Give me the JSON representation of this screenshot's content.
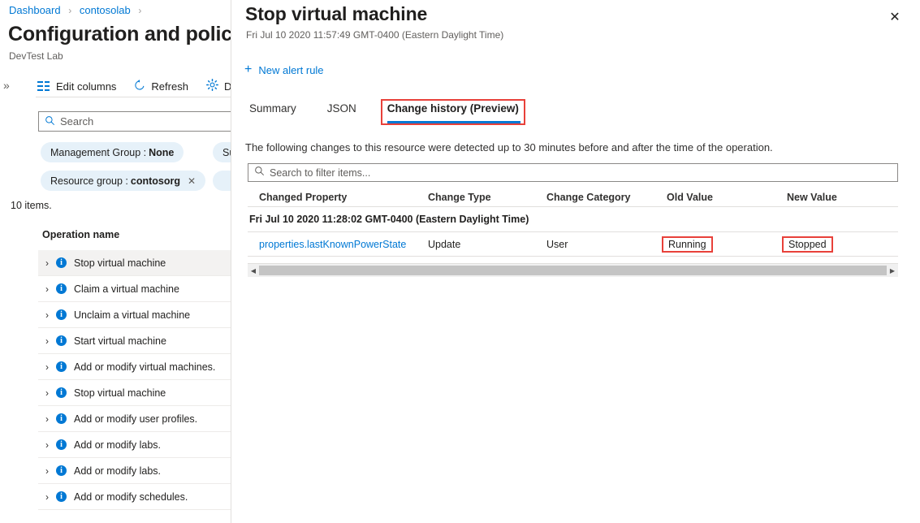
{
  "breadcrumb": {
    "items": [
      "Dashboard",
      "contosolab"
    ],
    "separator": "›"
  },
  "left_blade": {
    "title": "Configuration and policie",
    "subtitle": "DevTest Lab",
    "expand_icon": "»",
    "toolbar": [
      {
        "label": "Edit columns",
        "icon": "columns-icon"
      },
      {
        "label": "Refresh",
        "icon": "refresh-icon"
      },
      {
        "label": "D",
        "icon": "gear-icon"
      }
    ],
    "search": {
      "placeholder": "Search",
      "icon": "search-icon"
    },
    "filters": [
      {
        "label": "Management Group :",
        "value": "None",
        "removable": false
      },
      {
        "label": "Su",
        "value": "",
        "removable": false
      },
      {
        "label": "Resource group :",
        "value": "contosorg",
        "removable": true
      },
      {
        "label": "",
        "value": "",
        "removable": false
      }
    ],
    "items_count": "10 items.",
    "column_header": "Operation name",
    "operations": [
      {
        "label": "Stop virtual machine",
        "selected": true
      },
      {
        "label": "Claim a virtual machine",
        "selected": false
      },
      {
        "label": "Unclaim a virtual machine",
        "selected": false
      },
      {
        "label": "Start virtual machine",
        "selected": false
      },
      {
        "label": "Add or modify virtual machines.",
        "selected": false
      },
      {
        "label": "Stop virtual machine",
        "selected": false
      },
      {
        "label": "Add or modify user profiles.",
        "selected": false
      },
      {
        "label": "Add or modify labs.",
        "selected": false
      },
      {
        "label": "Add or modify labs.",
        "selected": false
      },
      {
        "label": "Add or modify schedules.",
        "selected": false
      }
    ]
  },
  "panel": {
    "title": "Stop virtual machine",
    "subtitle": "Fri Jul 10 2020 11:57:49 GMT-0400 (Eastern Daylight Time)",
    "close_icon": "✕",
    "command": {
      "label": "New alert rule",
      "icon": "plus-icon",
      "plus": "+"
    },
    "tabs": [
      {
        "label": "Summary",
        "active": false,
        "highlighted": false
      },
      {
        "label": "JSON",
        "active": false,
        "highlighted": false
      },
      {
        "label": "Change history (Preview)",
        "active": true,
        "highlighted": true
      }
    ],
    "description": "The following changes to this resource were detected up to 30 minutes before and after the time of the operation.",
    "filter": {
      "placeholder": "Search to filter items...",
      "icon": "search-icon"
    },
    "table": {
      "columns": [
        "Changed Property",
        "Change Type",
        "Change Category",
        "Old Value",
        "New Value"
      ],
      "group_label": "Fri Jul 10 2020 11:28:02 GMT-0400 (Eastern Daylight Time)",
      "rows": [
        {
          "changed_property": "properties.lastKnownPowerState",
          "change_type": "Update",
          "change_category": "User",
          "old_value": "Running",
          "new_value": "Stopped",
          "old_value_highlighted": true,
          "new_value_highlighted": true
        }
      ]
    },
    "scroll": {
      "left_arrow": "◀",
      "right_arrow": "▶"
    }
  },
  "colors": {
    "accent": "#0078d4",
    "highlight_box": "#e8413a",
    "pill_bg": "#e6f1f9",
    "selected_row": "#f3f2f1",
    "border": "#e1dfdd"
  }
}
